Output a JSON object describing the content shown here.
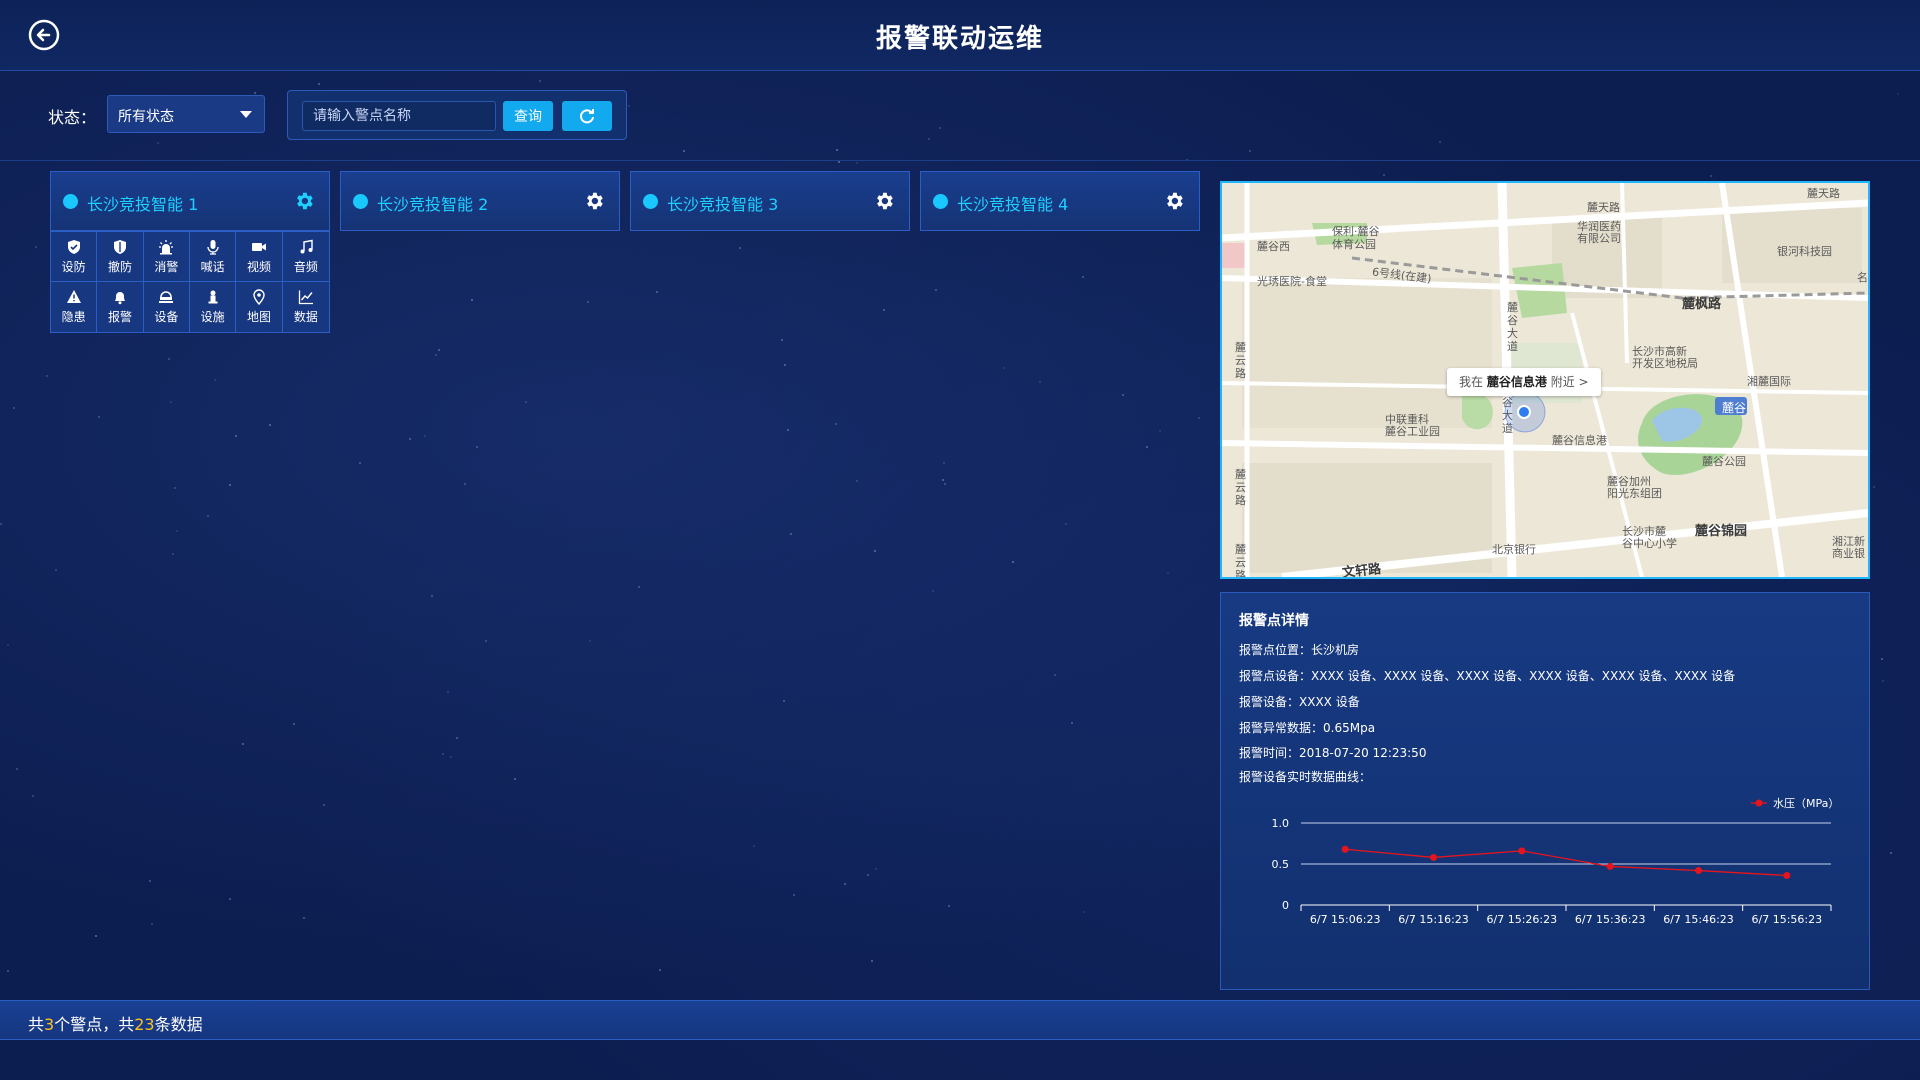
{
  "header": {
    "title": "报警联动运维"
  },
  "filter": {
    "status_label": "状态：",
    "status_value": "所有状态",
    "search_placeholder": "请输入警点名称",
    "query_label": "查询"
  },
  "points": [
    {
      "name": "长沙竞投智能 1",
      "active": true
    },
    {
      "name": "长沙竞投智能 2",
      "active": false
    },
    {
      "name": "长沙竞投智能 3",
      "active": false
    },
    {
      "name": "长沙竞投智能 4",
      "active": false
    }
  ],
  "operations": [
    {
      "label": "设防",
      "icon": "shield-check-icon"
    },
    {
      "label": "撤防",
      "icon": "shield-icon"
    },
    {
      "label": "消警",
      "icon": "alarm-light-icon"
    },
    {
      "label": "喊话",
      "icon": "microphone-icon"
    },
    {
      "label": "视频",
      "icon": "video-camera-icon"
    },
    {
      "label": "音频",
      "icon": "music-note-icon"
    },
    {
      "label": "隐患",
      "icon": "warning-triangle-icon"
    },
    {
      "label": "报警",
      "icon": "bell-icon"
    },
    {
      "label": "设备",
      "icon": "device-icon"
    },
    {
      "label": "设施",
      "icon": "facility-icon"
    },
    {
      "label": "地图",
      "icon": "map-pin-icon"
    },
    {
      "label": "数据",
      "icon": "line-chart-icon"
    }
  ],
  "map": {
    "popup_prefix": "我在",
    "popup_place": "麓谷信息港",
    "popup_suffix": "附近 >",
    "labels": {
      "l1": "麓天路",
      "l2": "麓谷西",
      "l3": "保利·麓谷",
      "l3b": "体育公园",
      "l4": "华润医药",
      "l4b": "有限公司",
      "l5": "银河科技园",
      "l6": "光琇医院-食堂",
      "l7": "6号线(在建)",
      "l8": "麓枫路",
      "l9": "长沙市高新",
      "l9b": "开发区地税局",
      "l10": "湘麓国际",
      "l11": "中联重科",
      "l11b": "麓谷工业园",
      "l12": "麓谷信息港",
      "l13": "麓谷公园",
      "l14": "麓谷加州",
      "l14b": "阳光东组团",
      "l15": "长沙市麓",
      "l15b": "谷中心小学",
      "l16": "麓谷锦园",
      "l17": "北京银行",
      "l18": "湘江新",
      "l18b": "商业银",
      "l19": "文轩路",
      "l20": "麓谷",
      "road_v1": "麓谷大道",
      "road_v2": "麓云路",
      "road_v3": "麓云路",
      "road_v4": "麓云路",
      "l21": "名",
      "l22": "谷大道"
    }
  },
  "details": {
    "title": "报警点详情",
    "location": "报警点位置：长沙机房",
    "devices": "报警点设备：XXXX 设备、XXXX 设备、XXXX 设备、XXXX 设备、XXXX 设备、XXXX 设备",
    "alarm_device": "报警设备：XXXX 设备",
    "abnormal_data": "报警异常数据：0.65Mpa",
    "alarm_time": "报警时间：2018-07-20  12:23:50",
    "curve_label": "报警设备实时数据曲线："
  },
  "chart_data": {
    "type": "line",
    "x": [
      "6/7 15:06:23",
      "6/7 15:16:23",
      "6/7 15:26:23",
      "6/7 15:36:23",
      "6/7 15:46:23",
      "6/7 15:56:23"
    ],
    "series": [
      {
        "name": "水压（MPa）",
        "values": [
          0.68,
          0.58,
          0.66,
          0.47,
          0.42,
          0.36
        ],
        "color": "#e8141c"
      }
    ],
    "ylim": [
      0,
      1.0
    ],
    "yticks": [
      "0",
      "0.5",
      "1.0"
    ],
    "grid": true,
    "legend": "top-right"
  },
  "footer": {
    "prefix": "共",
    "points_count": "3",
    "mid": "个警点，共",
    "data_count": "23",
    "suffix": "条数据"
  },
  "colors": {
    "accent": "#1fd0ff",
    "button": "#12a9ee",
    "highlight": "#ffc21a",
    "series": "#e8141c"
  }
}
